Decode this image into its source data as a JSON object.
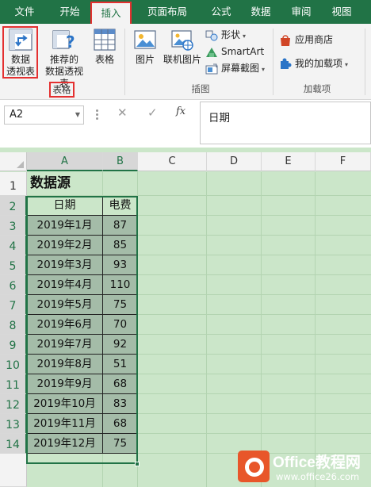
{
  "ribbon_tabs": [
    "文件",
    "开始",
    "插入",
    "页面布局",
    "公式",
    "数据",
    "审阅",
    "视图"
  ],
  "active_tab": "插入",
  "ribbon": {
    "pivot_table_line1": "数据",
    "pivot_table_line2": "透视表",
    "recommended_pivot_line1": "推荐的",
    "recommended_pivot_line2": "数据透视表",
    "table": "表格",
    "group_tables": "表格",
    "picture": "图片",
    "online_picture": "联机图片",
    "shapes": "形状",
    "smartart": "SmartArt",
    "screenshot": "屏幕截图",
    "group_illustrations": "插图",
    "app_store": "应用商店",
    "my_addins": "我的加载项",
    "group_addins": "加载项"
  },
  "formula_bar": {
    "name_box": "A2",
    "cancel_icon": "✕",
    "enter_icon": "✓",
    "fx": "fx",
    "content": "日期"
  },
  "columns": [
    "A",
    "B",
    "C",
    "D",
    "E",
    "F"
  ],
  "selected_columns": [
    "A",
    "B"
  ],
  "rows": [
    "1",
    "2",
    "3",
    "4",
    "5",
    "6",
    "7",
    "8",
    "9",
    "10",
    "11",
    "12",
    "13",
    "14"
  ],
  "sheet": {
    "title": "数据源",
    "header": [
      "日期",
      "电费"
    ],
    "data": [
      [
        "2019年1月",
        "87"
      ],
      [
        "2019年2月",
        "85"
      ],
      [
        "2019年3月",
        "93"
      ],
      [
        "2019年4月",
        "110"
      ],
      [
        "2019年5月",
        "75"
      ],
      [
        "2019年6月",
        "70"
      ],
      [
        "2019年7月",
        "92"
      ],
      [
        "2019年8月",
        "51"
      ],
      [
        "2019年9月",
        "68"
      ],
      [
        "2019年10月",
        "83"
      ],
      [
        "2019年11月",
        "68"
      ],
      [
        "2019年12月",
        "75"
      ]
    ]
  },
  "watermark": {
    "brand": "Office教程网",
    "url": "www.office26.com"
  },
  "colors": {
    "excel_green": "#217346",
    "highlight_red": "#e43030",
    "sheet_bg": "#cbe6c9",
    "data_fill": "#a4bca8",
    "watermark_orange": "#e8562a"
  }
}
